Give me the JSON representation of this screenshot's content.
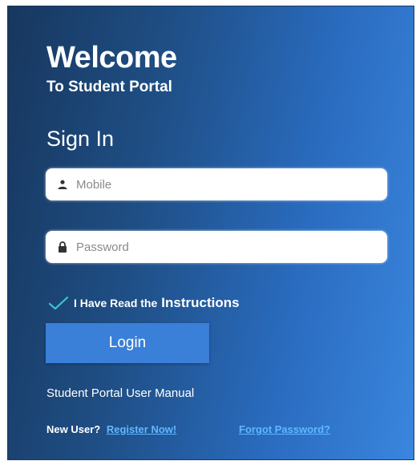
{
  "header": {
    "welcome": "Welcome",
    "subtitle": "To Student Portal"
  },
  "form": {
    "title": "Sign In",
    "mobile": {
      "placeholder": "Mobile",
      "value": "",
      "icon": "user-icon"
    },
    "password": {
      "placeholder": "Password",
      "value": "",
      "icon": "lock-icon"
    },
    "instructions_checkbox": {
      "checked": true,
      "label_prefix": "I Have Read the",
      "label_link": "Instructions"
    },
    "login_label": "Login"
  },
  "links": {
    "manual": "Student Portal User Manual",
    "new_user": "New User?",
    "register": "Register Now!",
    "forgot": "Forgot Password?"
  },
  "colors": {
    "gradient_start": "#17375e",
    "gradient_end": "#3a86de",
    "button": "#3a7fd8",
    "link": "#5fb8ff",
    "check": "#3fc3d0"
  }
}
